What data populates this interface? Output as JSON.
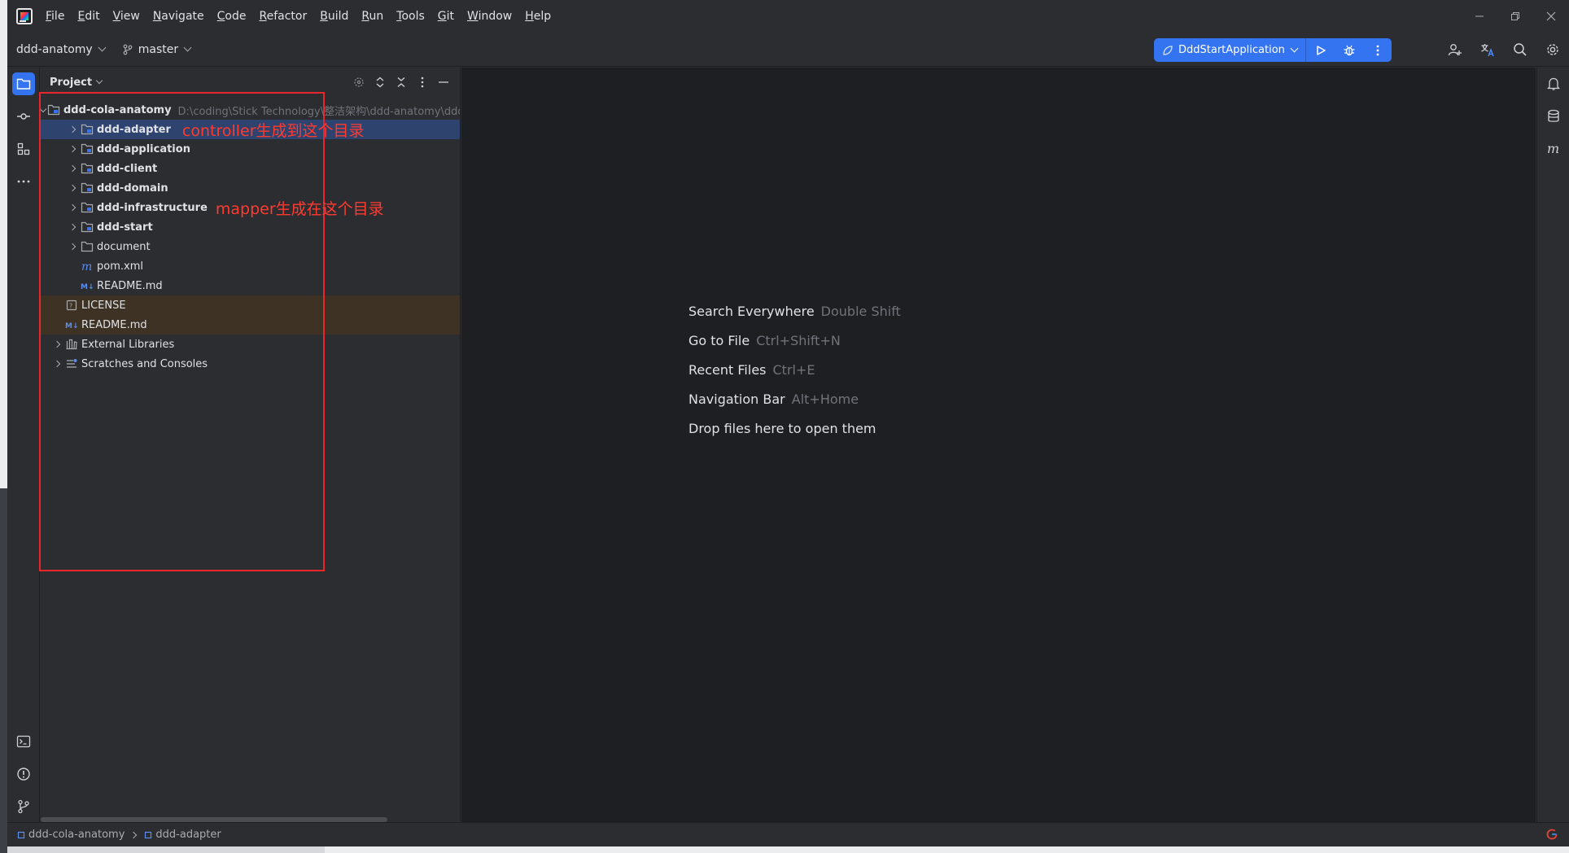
{
  "menu": {
    "items": [
      {
        "label": "File",
        "mnemonic": "F",
        "rest": "ile"
      },
      {
        "label": "Edit",
        "mnemonic": "E",
        "rest": "dit"
      },
      {
        "label": "View",
        "mnemonic": "V",
        "rest": "iew"
      },
      {
        "label": "Navigate",
        "mnemonic": "N",
        "rest": "avigate"
      },
      {
        "label": "Code",
        "mnemonic": "C",
        "rest": "ode"
      },
      {
        "label": "Refactor",
        "mnemonic": "R",
        "rest": "efactor"
      },
      {
        "label": "Build",
        "mnemonic": "B",
        "rest": "uild"
      },
      {
        "label": "Run",
        "mnemonic": "R",
        "rest": "un"
      },
      {
        "label": "Tools",
        "mnemonic": "T",
        "rest": "ools"
      },
      {
        "label": "Git",
        "mnemonic": "G",
        "rest": "it"
      },
      {
        "label": "Window",
        "mnemonic": "W",
        "rest": "indow"
      },
      {
        "label": "Help",
        "mnemonic": "H",
        "rest": "elp"
      }
    ]
  },
  "toolbar": {
    "project_name": "ddd-anatomy",
    "branch": "master",
    "run_config": "DddStartApplication"
  },
  "project_panel": {
    "title": "Project",
    "root": {
      "name": "ddd-cola-anatomy",
      "path": "D:\\coding\\Stick Technology\\整洁架构\\ddd-anatomy\\ddd"
    },
    "modules": [
      {
        "name": "ddd-adapter",
        "annotation": "controller生成到这个目录"
      },
      {
        "name": "ddd-application",
        "annotation": ""
      },
      {
        "name": "ddd-client",
        "annotation": ""
      },
      {
        "name": "ddd-domain",
        "annotation": ""
      },
      {
        "name": "ddd-infrastructure",
        "annotation": "mapper生成在这个目录"
      },
      {
        "name": "ddd-start",
        "annotation": ""
      }
    ],
    "folders": [
      {
        "name": "document"
      }
    ],
    "root_files": [
      {
        "name": "pom.xml",
        "icon": "maven-icon"
      },
      {
        "name": "README.md",
        "icon": "markdown-icon"
      }
    ],
    "top_files": [
      {
        "name": "LICENSE",
        "icon": "license-icon"
      },
      {
        "name": "README.md",
        "icon": "markdown-icon"
      }
    ],
    "extras": [
      {
        "name": "External Libraries"
      },
      {
        "name": "Scratches and Consoles"
      }
    ]
  },
  "editor": {
    "hints": [
      {
        "action": "Search Everywhere",
        "shortcut": "Double Shift"
      },
      {
        "action": "Go to File",
        "shortcut": "Ctrl+Shift+N"
      },
      {
        "action": "Recent Files",
        "shortcut": "Ctrl+E"
      },
      {
        "action": "Navigation Bar",
        "shortcut": "Alt+Home"
      },
      {
        "action": "Drop files here to open them",
        "shortcut": ""
      }
    ]
  },
  "statusbar": {
    "breadcrumbs": [
      "ddd-cola-anatomy",
      "ddd-adapter"
    ]
  },
  "colors": {
    "accent": "#3574f0",
    "selection": "#2e436e",
    "annotation": "#e8262b",
    "highlight_row": "#3d3223"
  }
}
